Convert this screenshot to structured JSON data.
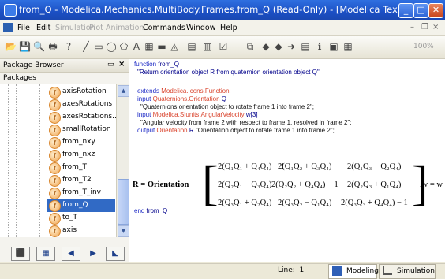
{
  "window": {
    "title": "from_Q - Modelica.Mechanics.MultiBody.Frames.from_Q  (Read-Only)  - [Modelica Text]"
  },
  "menubar": {
    "items": [
      "File",
      "Edit",
      "Simulation",
      "Plot",
      "Animation",
      "Commands",
      "Window",
      "Help"
    ],
    "dimmed": [
      false,
      false,
      true,
      true,
      true,
      false,
      false,
      false
    ]
  },
  "toolbar": {
    "zoom": "100%"
  },
  "package_browser": {
    "title": "Package Browser",
    "packages_label": "Packages",
    "items": [
      "axisRotation",
      "axesRotations",
      "axesRotations...",
      "smallRotation",
      "from_nxy",
      "from_nxz",
      "from_T",
      "from_T2",
      "from_T_inv",
      "from_Q",
      "to_T",
      "axis"
    ],
    "selected": "from_Q"
  },
  "code": {
    "l1_kw": "function",
    "l1_name": "from_Q",
    "l2": "\"Return orientation object R from quaternion orientation object Q\"",
    "l3_kw": "extends",
    "l3_cls": "Modelica.Icons.Function;",
    "l4_kw": "input",
    "l4_cls": "Quaternions.Orientation",
    "l4_var": "Q",
    "l5": "\"Quaternions orientation object to rotate frame 1 into frame 2\";",
    "l6_kw": "input",
    "l6_cls": "Modelica.SIunits.AngularVelocity",
    "l6_var": "w[3]",
    "l7": "\"Angular velocity from frame 2 with respect to frame 1, resolved in frame 2\";",
    "l8_kw": "output",
    "l8_cls": "Orientation",
    "l8_var": "R",
    "l8_str": "\"Orientation object to rotate frame 1 into frame 2\";",
    "end_kw": "end",
    "end_name": "from_Q"
  },
  "equation": {
    "lhs": "R = Orientation",
    "rhs": ",w = w",
    "rows": [
      [
        "2(Q₁Q₁ + Q₄Q₄) − 1",
        "2(Q₁Q₂ + Q₃Q₄)",
        "2(Q₁Q₃ − Q₂Q₄)"
      ],
      [
        "2(Q₂Q₁ − Q₃Q₄)",
        "2(Q₂Q₂ + Q₄Q₄) − 1",
        "2(Q₂Q₃ + Q₁Q₄)"
      ],
      [
        "2(Q₃Q₁ + Q₂Q₄)",
        "2(Q₃Q₂ − Q₁Q₄)",
        "2(Q₃Q₃ + Q₄Q₄) − 1"
      ]
    ]
  },
  "statusbar": {
    "line_label": "Line:",
    "line_value": "1",
    "modeling": "Modeling",
    "simulation": "Simulation"
  }
}
